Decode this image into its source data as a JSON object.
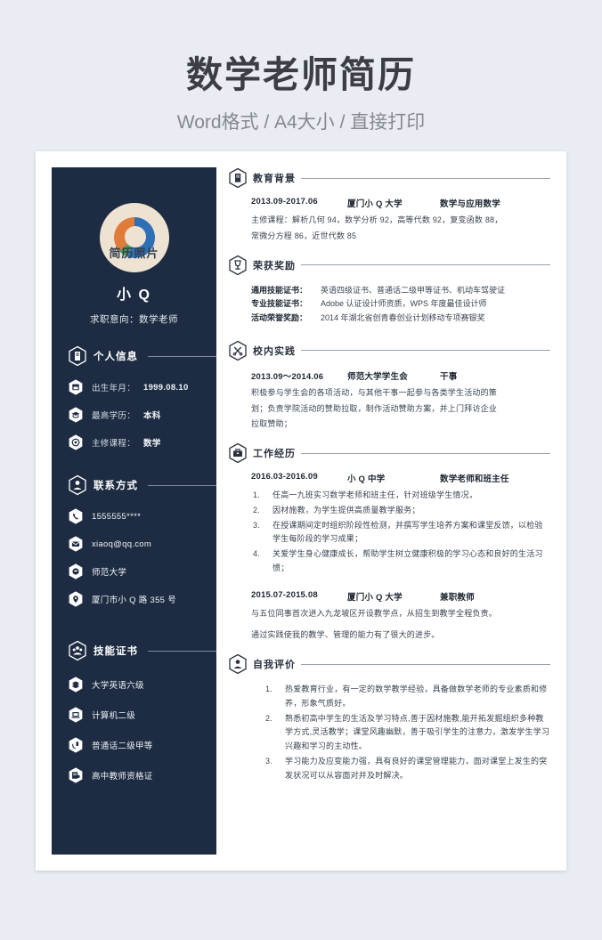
{
  "header": {
    "title": "数学老师简历",
    "subtitle": "Word格式 / A4大小 / 直接打印"
  },
  "colors": {
    "page_background": "#e9edf3",
    "sidebar": "#1d2c42",
    "sheet": "#ffffff",
    "title_text": "#3b3f45",
    "subtitle_text": "#85898f",
    "photo_background": "#eee3d2",
    "photo_orange": "#e07b39",
    "photo_green": "#4a9a5a",
    "photo_blue": "#2f6fb5"
  },
  "sidebar": {
    "photo_label": "简历照片",
    "name": "小 Q",
    "objective": "求职意向：数学老师",
    "sections": [
      {
        "title": "个人信息",
        "icon": "document-icon",
        "rows": [
          {
            "icon": "calendar-icon",
            "label": "出生年月：",
            "value": "1999.08.10"
          },
          {
            "icon": "graduation-cap-icon",
            "label": "最高学历：",
            "value": "本科"
          },
          {
            "icon": "gear-icon",
            "label": "主修课程：",
            "value": "数学"
          }
        ]
      },
      {
        "title": "联系方式",
        "icon": "person-icon",
        "rows": [
          {
            "icon": "phone-icon",
            "value": "1555555****"
          },
          {
            "icon": "mail-icon",
            "value": "xiaoq@qq.com"
          },
          {
            "icon": "school-icon",
            "value": "师范大学"
          },
          {
            "icon": "location-pin-icon",
            "value": "厦门市小 Q 路 355 号"
          }
        ]
      },
      {
        "title": "技能证书",
        "icon": "people-icon",
        "rows": [
          {
            "icon": "books-icon",
            "value": "大学英语六级"
          },
          {
            "icon": "laptop-icon",
            "value": "计算机二级"
          },
          {
            "icon": "microphone-icon",
            "value": "普通话二级甲等"
          },
          {
            "icon": "certificate-icon",
            "value": "高中教师资格证"
          }
        ]
      }
    ]
  },
  "content": {
    "education": {
      "title": "教育背景",
      "icon": "document-icon",
      "date": "2013.09-2017.06",
      "org": "厦门小 Q 大学",
      "role": "数学与应用数学",
      "lines": [
        "主修课程：解析几何 94，数学分析 92，高等代数 92，复变函数 88，",
        "常微分方程 86，近世代数 85"
      ]
    },
    "awards": {
      "title": "荣获奖励",
      "icon": "trophy-icon",
      "rows": [
        {
          "key": "通用技能证书：",
          "value": "英语四级证书、普通话二级甲等证书、机动车驾驶证"
        },
        {
          "key": "专业技能证书：",
          "value": "Adobe 认证设计师资质，WPS 年度最佳设计师"
        },
        {
          "key": "活动荣誉奖励：",
          "value": "2014 年湖北省创青春创业计划移动专项赛银奖"
        }
      ]
    },
    "campus": {
      "title": "校内实践",
      "icon": "tools-icon",
      "date": "2013.09～2014.06",
      "org": "师范大学学生会",
      "role": "干事",
      "lines": [
        "积极参与学生会的各项活动，与其他干事一起参与各类学生活动的策",
        "划；负责学院活动的赞助拉取，制作活动赞助方案，并上门拜访企业",
        "拉取赞助；"
      ]
    },
    "work": {
      "title": "工作经历",
      "icon": "briefcase-icon",
      "entries": [
        {
          "date": "2016.03-2016.09",
          "org": "小 Q 中学",
          "role": "数学老师和班主任",
          "items": [
            "任高一九班实习数学老师和班主任，针对班级学生情况，",
            "因材施教，为学生提供高质量教学服务；",
            "在授课期间定时组织阶段性检测，并撰写学生培养方案和课堂反馈，以检验学生每阶段的学习成果；",
            "关爱学生身心健康成长，帮助学生树立健康积极的学习心态和良好的生活习惯；"
          ]
        },
        {
          "date": "2015.07-2015.08",
          "org": "厦门小 Q 大学",
          "role": "兼职教师",
          "paragraphs": [
            "与五位同事首次进入九龙坡区开设教学点，从招生到教学全程负责。",
            "通过实践使我的教学、管理的能力有了很大的进步。"
          ]
        }
      ]
    },
    "self_evaluation": {
      "title": "自我评价",
      "icon": "user-badge-icon",
      "items": [
        "热爱教育行业，有一定的数学教学经验，具备做数学老师的专业素质和修养，形象气质好。",
        "熟悉初高中学生的生活及学习特点,善于因材施教,能开拓发掘组织多种教学方式,灵活教学；课堂风趣幽默，善于吸引学生的注意力，激发学生学习兴趣和学习的主动性。",
        "学习能力及应变能力强，具有良好的课堂管理能力，面对课堂上发生的突发状况可以从容面对并及时解决。"
      ]
    }
  }
}
